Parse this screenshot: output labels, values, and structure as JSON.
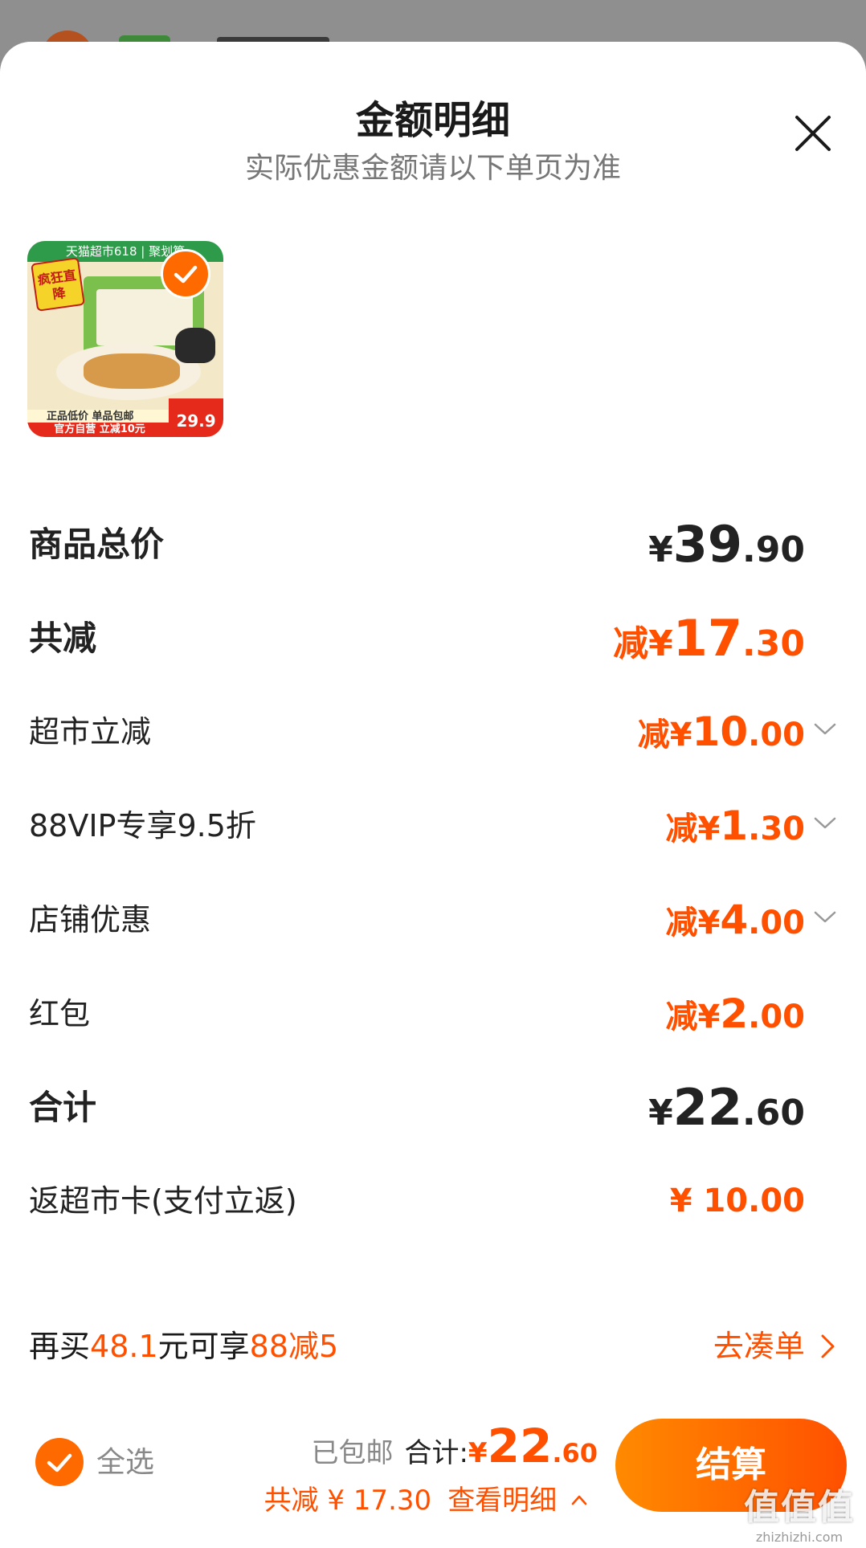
{
  "sheet": {
    "title": "金额明细",
    "subtitle": "实际优惠金额请以下单页为准",
    "close_icon": "close-icon"
  },
  "product": {
    "checked": true,
    "thumb_texts": {
      "top_banner": "天猫超市618 | 聚划算",
      "badge": "疯狂直降",
      "band1": "正品低价 单品包邮",
      "band2": "官方自营 立减10元",
      "price": "29.9"
    }
  },
  "rows": {
    "total_price": {
      "label": "商品总价",
      "symbol": "¥",
      "int": "39",
      "dec": ".90"
    },
    "total_discount": {
      "label": "共减",
      "prefix": "减",
      "symbol": "¥",
      "int": "17",
      "dec": ".30"
    },
    "supermarket_discount": {
      "label": "超市立减",
      "prefix": "减",
      "symbol": "¥",
      "int": "10",
      "dec": ".00"
    },
    "vip_discount": {
      "label": "88VIP专享9.5折",
      "prefix": "减",
      "symbol": "¥",
      "int": "1",
      "dec": ".30"
    },
    "store_discount": {
      "label": "店铺优惠",
      "prefix": "减",
      "symbol": "¥",
      "int": "4",
      "dec": ".00"
    },
    "red_packet": {
      "label": "红包",
      "prefix": "减",
      "symbol": "¥",
      "int": "2",
      "dec": ".00"
    },
    "subtotal": {
      "label": "合计",
      "symbol": "¥",
      "int": "22",
      "dec": ".60"
    },
    "cashback": {
      "label": "返超市卡(支付立返)",
      "value": "¥ 10.00"
    }
  },
  "promo": {
    "text_1": "再买",
    "amount": "48.1",
    "text_2": "元可享",
    "offer": "88减5",
    "link_label": "去凑单"
  },
  "footer": {
    "select_all_label": "全选",
    "shipping": "已包邮",
    "total_label": "合计:",
    "total_symbol": "¥",
    "total_int": "22",
    "total_dec": ".60",
    "discount_text": "共减 ¥ 17.30",
    "detail_link": "查看明细",
    "checkout_label": "结算"
  },
  "watermark": {
    "main": "值值值",
    "sub": "zhizhizhi.com"
  },
  "colors": {
    "accent": "#ff5000",
    "accent_light": "#ff8a00",
    "text_dark": "#222222",
    "text_muted": "#888888"
  }
}
